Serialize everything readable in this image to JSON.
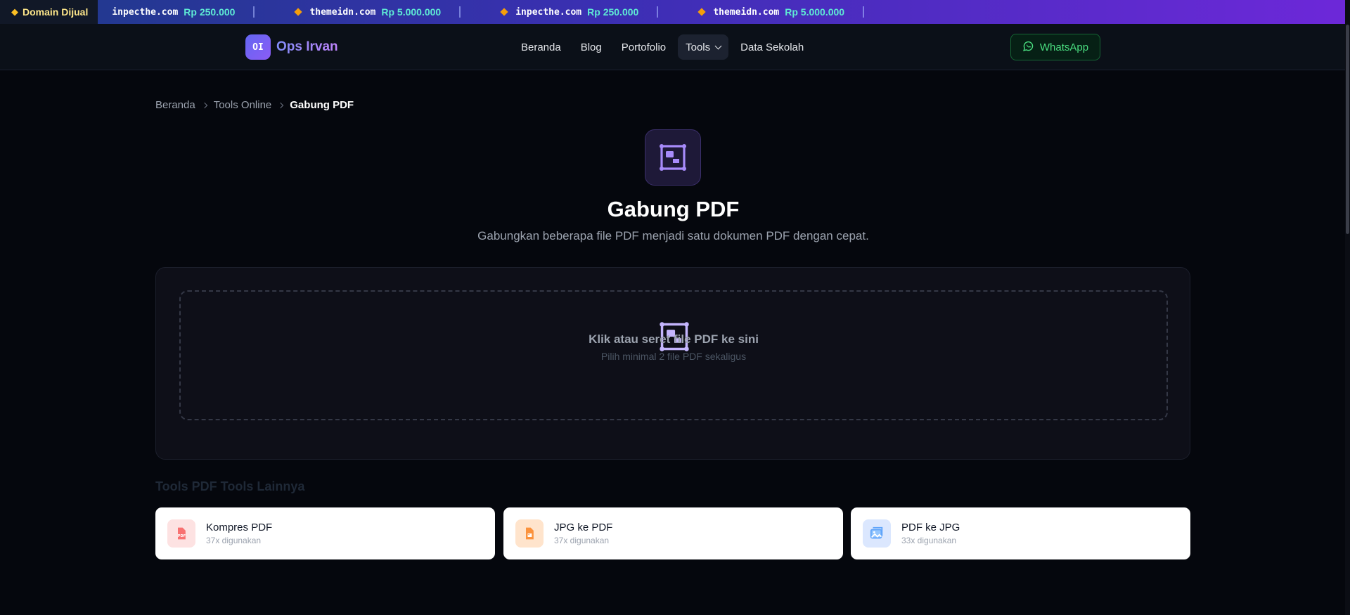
{
  "ticker": {
    "badge_label": "Domain Dijual",
    "items": [
      {
        "domain": "inpecthe.com",
        "price": "Rp 250.000"
      },
      {
        "domain": "themeidn.com",
        "price": "Rp 5.000.000"
      },
      {
        "domain": "inpecthe.com",
        "price": "Rp 250.000"
      },
      {
        "domain": "themeidn.com",
        "price": "Rp 5.000.000"
      }
    ]
  },
  "brand": {
    "logo_text": "OI",
    "name": "Ops Irvan"
  },
  "nav": {
    "items": [
      {
        "label": "Beranda"
      },
      {
        "label": "Blog"
      },
      {
        "label": "Portofolio"
      },
      {
        "label": "Tools"
      },
      {
        "label": "Data Sekolah"
      }
    ],
    "whatsapp_label": "WhatsApp"
  },
  "breadcrumb": {
    "items": [
      "Beranda",
      "Tools Online"
    ],
    "current": "Gabung PDF"
  },
  "hero": {
    "title": "Gabung PDF",
    "subtitle": "Gabungkan beberapa file PDF menjadi satu dokumen PDF dengan cepat."
  },
  "upload": {
    "title": "Klik atau seret file PDF ke sini",
    "hint": "Pilih minimal 2 file PDF sekaligus"
  },
  "related": {
    "title": "Tools PDF Tools Lainnya",
    "tools": [
      {
        "name": "Kompres PDF",
        "usage": "37x digunakan",
        "icon": "pdf-file-icon",
        "color": "#ef4444",
        "bg": "#fde2e2"
      },
      {
        "name": "JPG ke PDF",
        "usage": "37x digunakan",
        "icon": "image-file-icon",
        "color": "#f97316",
        "bg": "#ffe4cc"
      },
      {
        "name": "PDF ke JPG",
        "usage": "33x digunakan",
        "icon": "gallery-icon",
        "color": "#3b82f6",
        "bg": "#dbe7fe"
      }
    ]
  },
  "colors": {
    "accent": "#8b5cf6",
    "whatsapp": "#4ade80",
    "price": "#5eead4"
  }
}
